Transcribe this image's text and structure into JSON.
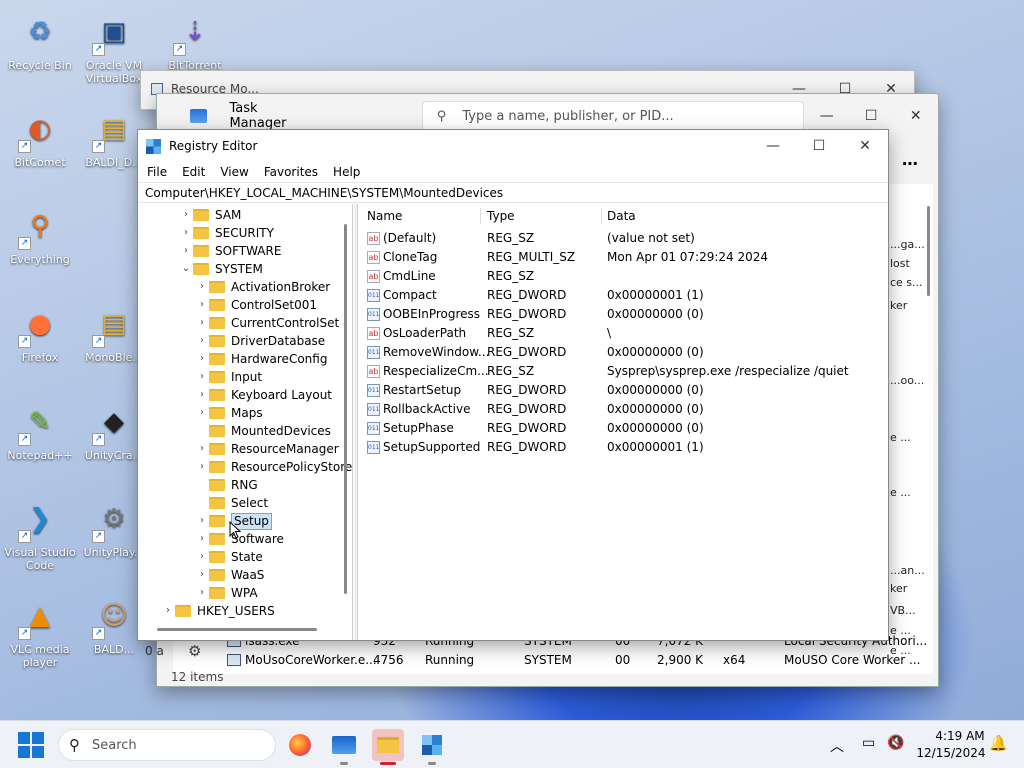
{
  "desktop": {
    "icons": [
      {
        "label": "Recycle Bin",
        "glyph": "♻",
        "color": "#4a90d9",
        "icon": "recycle-bin-icon"
      },
      {
        "label": "Oracle VM VirtualBox",
        "glyph": "▣",
        "color": "#1d4f91",
        "icon": "virtualbox-icon"
      },
      {
        "label": "BitTorrent",
        "glyph": "⇣",
        "color": "#7a4fd0",
        "icon": "bittorrent-icon"
      },
      {
        "label": "BitComet",
        "glyph": "◐",
        "color": "#e25822",
        "icon": "bitcomet-icon"
      },
      {
        "label": "BALDI_D...",
        "glyph": "▤",
        "color": "#e8b22f",
        "icon": "folder-icon"
      },
      {
        "label": "Everything",
        "glyph": "⚲",
        "color": "#f07a1a",
        "icon": "everything-search-icon"
      },
      {
        "label": "Firefox",
        "glyph": "●",
        "color": "#ff7139",
        "icon": "firefox-icon"
      },
      {
        "label": "MonoBle...",
        "glyph": "▤",
        "color": "#e8b22f",
        "icon": "folder-icon"
      },
      {
        "label": "Notepad++",
        "glyph": "✎",
        "color": "#7cc142",
        "icon": "notepadpp-icon"
      },
      {
        "label": "UnityCra...",
        "glyph": "◆",
        "color": "#222",
        "icon": "unity-icon"
      },
      {
        "label": "Visual Studio Code",
        "glyph": "❯",
        "color": "#1f8ad2",
        "icon": "vscode-icon"
      },
      {
        "label": "UnityPlay...",
        "glyph": "⚙",
        "color": "#777",
        "icon": "unity-player-icon"
      },
      {
        "label": "VLC media player",
        "glyph": "▲",
        "color": "#f08c00",
        "icon": "vlc-icon"
      },
      {
        "label": "BALD...",
        "glyph": "☺",
        "color": "#d9a066",
        "icon": "baldi-icon"
      }
    ]
  },
  "behind_window": {
    "title": "Resource Mo..."
  },
  "task_manager": {
    "title": "Task Manager",
    "search_placeholder": "Type a name, publisher, or PID...",
    "right_snippets": [
      "...ga...",
      "lost",
      "ce s...",
      "ker",
      "...oo...",
      "e ...",
      "e ...",
      "...an...",
      "ker",
      "VB...",
      "e ...",
      "e ..."
    ],
    "rows": [
      {
        "name": "lsass.exe",
        "pid": "932",
        "status": "Running",
        "user": "SYSTEM",
        "cpu": "00",
        "mem": "7,072 K",
        "arch": "",
        "desc": "Local Security Authori..."
      },
      {
        "name": "MoUsoCoreWorker.e...",
        "pid": "4756",
        "status": "Running",
        "user": "SYSTEM",
        "cpu": "00",
        "mem": "2,900 K",
        "arch": "x64",
        "desc": "MoUSO Core Worker ..."
      }
    ],
    "items_count": "12 items",
    "side_frag": "0 a"
  },
  "regedit": {
    "title": "Registry Editor",
    "menu": [
      "File",
      "Edit",
      "View",
      "Favorites",
      "Help"
    ],
    "address": "Computer\\HKEY_LOCAL_MACHINE\\SYSTEM\\MountedDevices",
    "tree": [
      {
        "label": "SAM",
        "level": 1,
        "chev": "›"
      },
      {
        "label": "SECURITY",
        "level": 1,
        "chev": "›"
      },
      {
        "label": "SOFTWARE",
        "level": 1,
        "chev": "›"
      },
      {
        "label": "SYSTEM",
        "level": 1,
        "chev": "⌄"
      },
      {
        "label": "ActivationBroker",
        "level": 2,
        "chev": "›"
      },
      {
        "label": "ControlSet001",
        "level": 2,
        "chev": "›"
      },
      {
        "label": "CurrentControlSet",
        "level": 2,
        "chev": "›"
      },
      {
        "label": "DriverDatabase",
        "level": 2,
        "chev": "›"
      },
      {
        "label": "HardwareConfig",
        "level": 2,
        "chev": "›"
      },
      {
        "label": "Input",
        "level": 2,
        "chev": "›"
      },
      {
        "label": "Keyboard Layout",
        "level": 2,
        "chev": "›"
      },
      {
        "label": "Maps",
        "level": 2,
        "chev": "›"
      },
      {
        "label": "MountedDevices",
        "level": 2,
        "chev": ""
      },
      {
        "label": "ResourceManager",
        "level": 2,
        "chev": "›"
      },
      {
        "label": "ResourcePolicyStore",
        "level": 2,
        "chev": "›"
      },
      {
        "label": "RNG",
        "level": 2,
        "chev": ""
      },
      {
        "label": "Select",
        "level": 2,
        "chev": ""
      },
      {
        "label": "Setup",
        "level": 2,
        "chev": "›",
        "selected": true
      },
      {
        "label": "Software",
        "level": 2,
        "chev": "›"
      },
      {
        "label": "State",
        "level": 2,
        "chev": "›"
      },
      {
        "label": "WaaS",
        "level": 2,
        "chev": "›"
      },
      {
        "label": "WPA",
        "level": 2,
        "chev": "›"
      },
      {
        "label": "HKEY_USERS",
        "level": 0,
        "chev": "›"
      }
    ],
    "columns": {
      "name": "Name",
      "type": "Type",
      "data": "Data"
    },
    "values": [
      {
        "name": "(Default)",
        "type": "REG_SZ",
        "data": "(value not set)",
        "kind": "ab"
      },
      {
        "name": "CloneTag",
        "type": "REG_MULTI_SZ",
        "data": "Mon Apr 01 07:29:24 2024",
        "kind": "ab"
      },
      {
        "name": "CmdLine",
        "type": "REG_SZ",
        "data": "",
        "kind": "ab"
      },
      {
        "name": "Compact",
        "type": "REG_DWORD",
        "data": "0x00000001 (1)",
        "kind": "bin"
      },
      {
        "name": "OOBEInProgress",
        "type": "REG_DWORD",
        "data": "0x00000000 (0)",
        "kind": "bin"
      },
      {
        "name": "OsLoaderPath",
        "type": "REG_SZ",
        "data": "\\",
        "kind": "ab"
      },
      {
        "name": "RemoveWindow...",
        "type": "REG_DWORD",
        "data": "0x00000000 (0)",
        "kind": "bin"
      },
      {
        "name": "RespecializeCm...",
        "type": "REG_SZ",
        "data": "Sysprep\\sysprep.exe /respecialize /quiet",
        "kind": "ab"
      },
      {
        "name": "RestartSetup",
        "type": "REG_DWORD",
        "data": "0x00000000 (0)",
        "kind": "bin"
      },
      {
        "name": "RollbackActive",
        "type": "REG_DWORD",
        "data": "0x00000000 (0)",
        "kind": "bin"
      },
      {
        "name": "SetupPhase",
        "type": "REG_DWORD",
        "data": "0x00000000 (0)",
        "kind": "bin"
      },
      {
        "name": "SetupSupported",
        "type": "REG_DWORD",
        "data": "0x00000001 (1)",
        "kind": "bin"
      }
    ]
  },
  "taskbar": {
    "search": "Search",
    "time": "4:19 AM",
    "date": "12/15/2024"
  }
}
